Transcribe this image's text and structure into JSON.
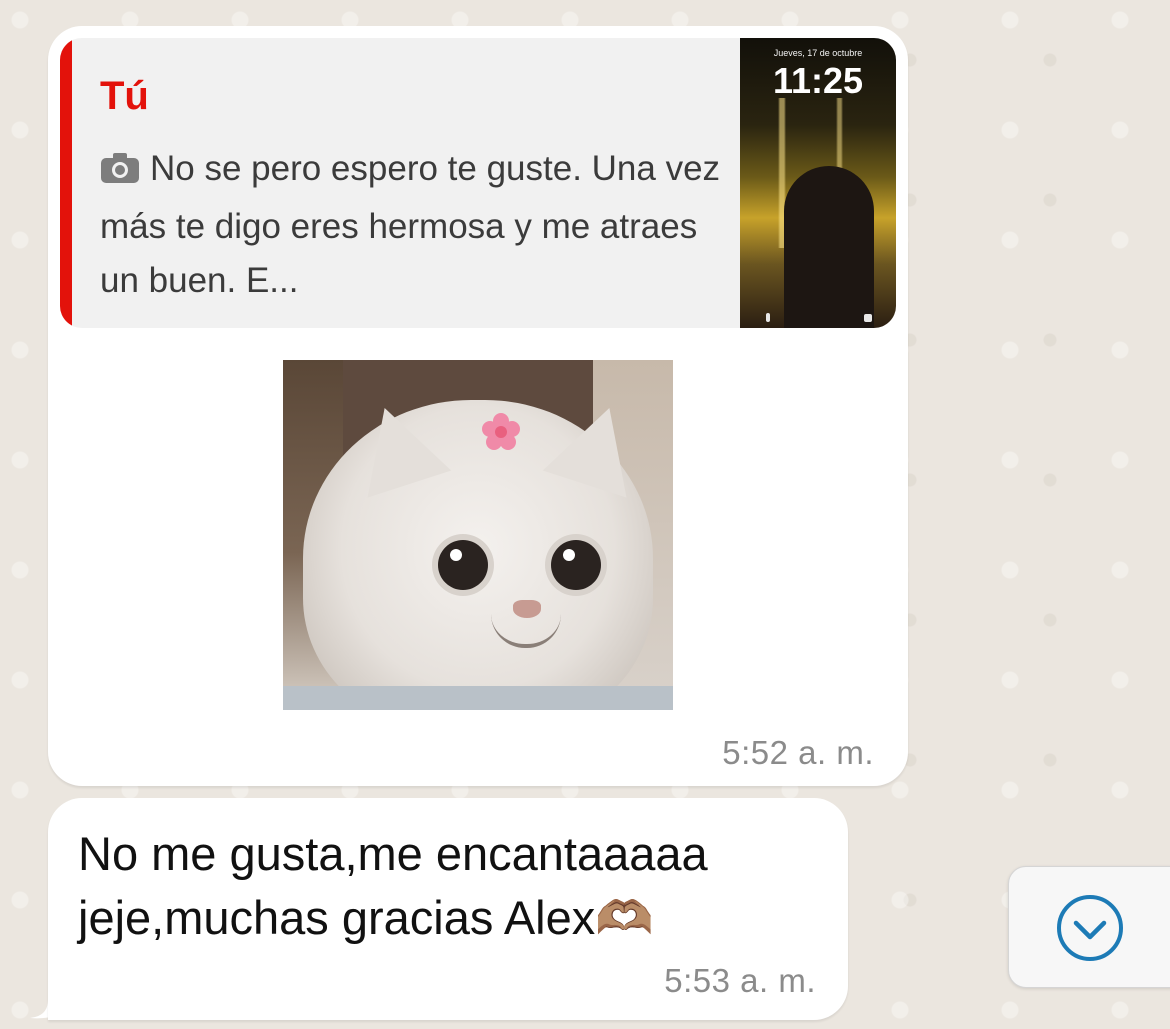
{
  "reply_quote": {
    "author": "Tú",
    "icon": "camera-icon",
    "text": "No se pero espero te guste. Una vez más te digo eres hermosa y me atraes un buen. E...",
    "thumbnail": {
      "date": "Jueves, 17 de octubre",
      "time": "11:25"
    }
  },
  "message1": {
    "sticker": "cat-sticker",
    "time": "5:52 a. m."
  },
  "message2": {
    "text": "No me gusta,me encantaaaaa jeje,muchas gracias Alex🫶🏽",
    "time": "5:53 a. m."
  },
  "scroll_button": {
    "icon": "chevron-down-icon"
  },
  "colors": {
    "quote_accent": "#e3120b",
    "bubble": "#ffffff",
    "background": "#ebe6df",
    "scroll_icon": "#1d7bb6"
  }
}
